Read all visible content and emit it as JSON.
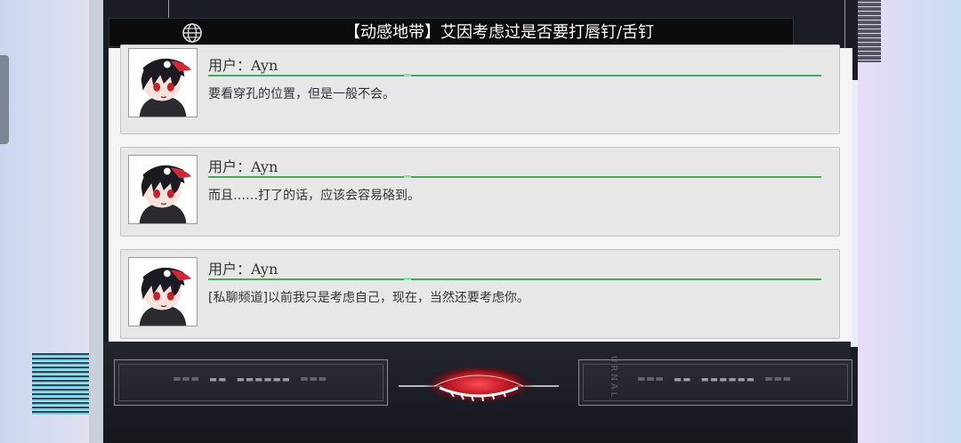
{
  "title": "【动感地带】艾因考虑过是否要打唇钉/舌钉",
  "icons": {
    "globe": "globe-icon",
    "eye": "eye-emblem-icon"
  },
  "messages": [
    {
      "sender": "用户：Ayn",
      "text": "要看穿孔的位置，但是一般不会。"
    },
    {
      "sender": "用户：Ayn",
      "text": "而且……打了的话，应该会容易硌到。"
    },
    {
      "sender": "用户：Ayn",
      "text": "[私聊频道]以前我只是考虑自己，现在，当然还要考虑你。"
    }
  ],
  "decor": {
    "left_label": "═══ ▬▬ ▬▬▬▬▬▬ ═══",
    "right_label": "═══ ▬▬ ▬▬▬▬▬▬ ═══",
    "vertical_text": "URNAL"
  },
  "colors": {
    "accent_green": "#3fae5b",
    "frame": "#1b1d24",
    "eye_red": "#d8202e"
  }
}
